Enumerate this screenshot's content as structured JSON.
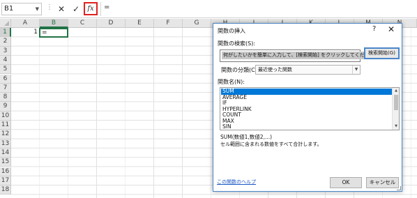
{
  "formula_bar": {
    "name_box": "B1",
    "separator": "⋮",
    "cancel_symbol": "✕",
    "enter_symbol": "✓",
    "fx_label": "fx",
    "formula": "="
  },
  "columns": [
    "A",
    "B",
    "C",
    "D",
    "E",
    "F",
    "G",
    "H",
    "I",
    "J",
    "K",
    "L",
    "M",
    "N"
  ],
  "rows": [
    "1",
    "2",
    "3",
    "4",
    "5",
    "6",
    "7",
    "8",
    "9",
    "10",
    "11",
    "12",
    "13",
    "14",
    "15",
    "16",
    "17",
    "18"
  ],
  "cells": {
    "A1": "1",
    "B1": "="
  },
  "dialog": {
    "title": "関数の挿入",
    "help_symbol": "?",
    "close_symbol": "✕",
    "search_label": "関数の検索(S):",
    "search_value": "何がしたいかを簡単に入力して、[検索開始] をクリックしてください。",
    "search_button": "検索開始(G)",
    "category_label": "関数の分類(C):",
    "category_value": "最近使った関数",
    "function_name_label": "関数名(N):",
    "functions": [
      "SUM",
      "AVERAGE",
      "IF",
      "HYPERLINK",
      "COUNT",
      "MAX",
      "SIN"
    ],
    "selected_function": "SUM",
    "signature": "SUM(数値1,数値2,...)",
    "description": "セル範囲に含まれる数値をすべて合計します。",
    "help_link": "この関数のヘルプ",
    "ok_button": "OK",
    "cancel_button": "キャンセル"
  },
  "colors": {
    "excel_green": "#217346",
    "accent_blue": "#0078d7",
    "fx_highlight": "#e02020"
  }
}
